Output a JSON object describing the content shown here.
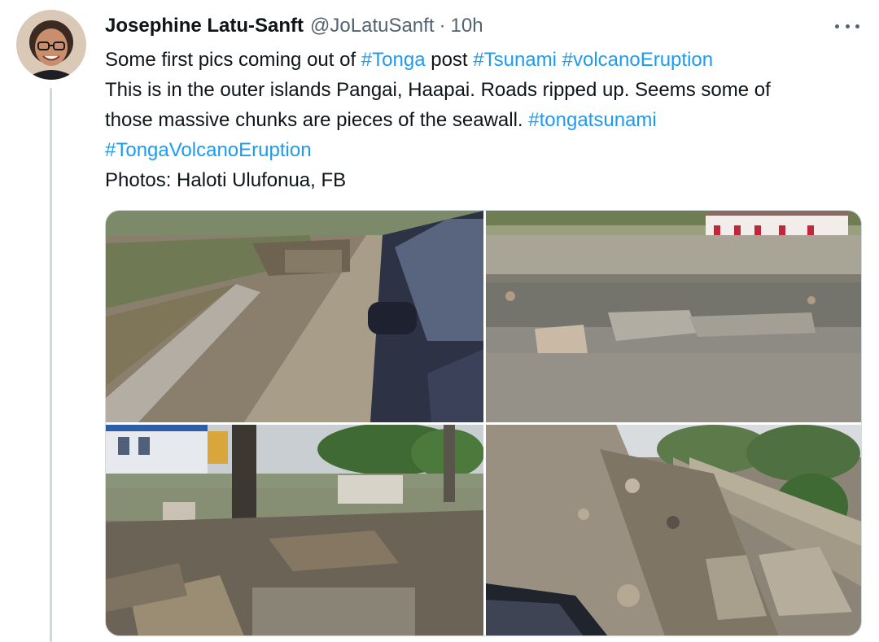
{
  "tweet": {
    "author_name": "Josephine Latu-Sanft",
    "handle": "@JoLatuSanft",
    "separator": "·",
    "time": "10h",
    "more_icon": "ellipsis-icon",
    "lines": {
      "l1_pre": "Some first pics coming out of ",
      "l1_tag1": "#Tonga",
      "l1_mid": " post ",
      "l1_tag2": "#Tsunami",
      "l1_sp": " ",
      "l1_tag3": "#volcanoEruption",
      "l2": "This is in the outer islands Pangai, Haapai. Roads ripped up. Seems some of",
      "l3_pre": "those massive chunks are pieces of the seawall. ",
      "l3_tag": "#tongatsunami",
      "l4_tag": "#TongaVolcanoEruption",
      "l5": "Photos: Haloti Ulufonua, FB"
    }
  },
  "colors": {
    "link": "#1d9bf0",
    "text": "#0f1419",
    "secondary": "#536471",
    "border": "#cfd9de"
  }
}
